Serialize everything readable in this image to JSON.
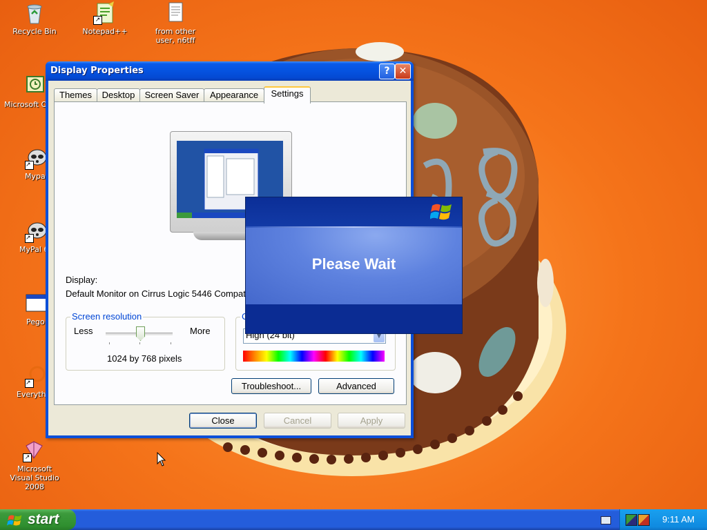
{
  "desktop": {
    "icons": [
      {
        "label": "Recycle Bin",
        "icon": "recycle-bin-icon"
      },
      {
        "label": "Notepad++",
        "icon": "notepad-plus-plus-icon"
      },
      {
        "label": "from other user, n6tff",
        "icon": "text-document-icon"
      },
      {
        "label": "Microsoft Ou",
        "icon": "outlook-icon"
      },
      {
        "label": "Mypal",
        "icon": "mypal-icon"
      },
      {
        "label": "MyPal 6",
        "icon": "mypal-icon"
      },
      {
        "label": "Pego",
        "icon": "window-app-icon"
      },
      {
        "label": "Everythi",
        "icon": "everything-search-icon"
      },
      {
        "label": "Microsoft Visual Studio 2008",
        "icon": "visual-studio-icon"
      }
    ]
  },
  "window": {
    "title": "Display Properties",
    "tabs": [
      "Themes",
      "Desktop",
      "Screen Saver",
      "Appearance",
      "Settings"
    ],
    "active_tab": "Settings",
    "display_label": "Display:",
    "display_value": "Default Monitor on Cirrus Logic 5446 Compat",
    "resolution": {
      "title": "Screen resolution",
      "less": "Less",
      "more": "More",
      "value": "1024 by 768 pixels",
      "slider_position": 0.5
    },
    "color_quality": {
      "title_partial": "C",
      "value": "High (24 bit)"
    },
    "buttons": {
      "troubleshoot": "Troubleshoot...",
      "advanced": "Advanced",
      "close": "Close",
      "cancel": "Cancel",
      "apply": "Apply"
    }
  },
  "wait_dialog": {
    "message": "Please Wait"
  },
  "taskbar": {
    "start": "start",
    "clock": "9:11 AM"
  },
  "colors": {
    "desktop_bg": "#f5741a",
    "title_bar": "#0553e0",
    "tab_highlight": "#ffc83c",
    "start_green": "#3c9a3c",
    "tray_blue": "#0f8ae0"
  }
}
